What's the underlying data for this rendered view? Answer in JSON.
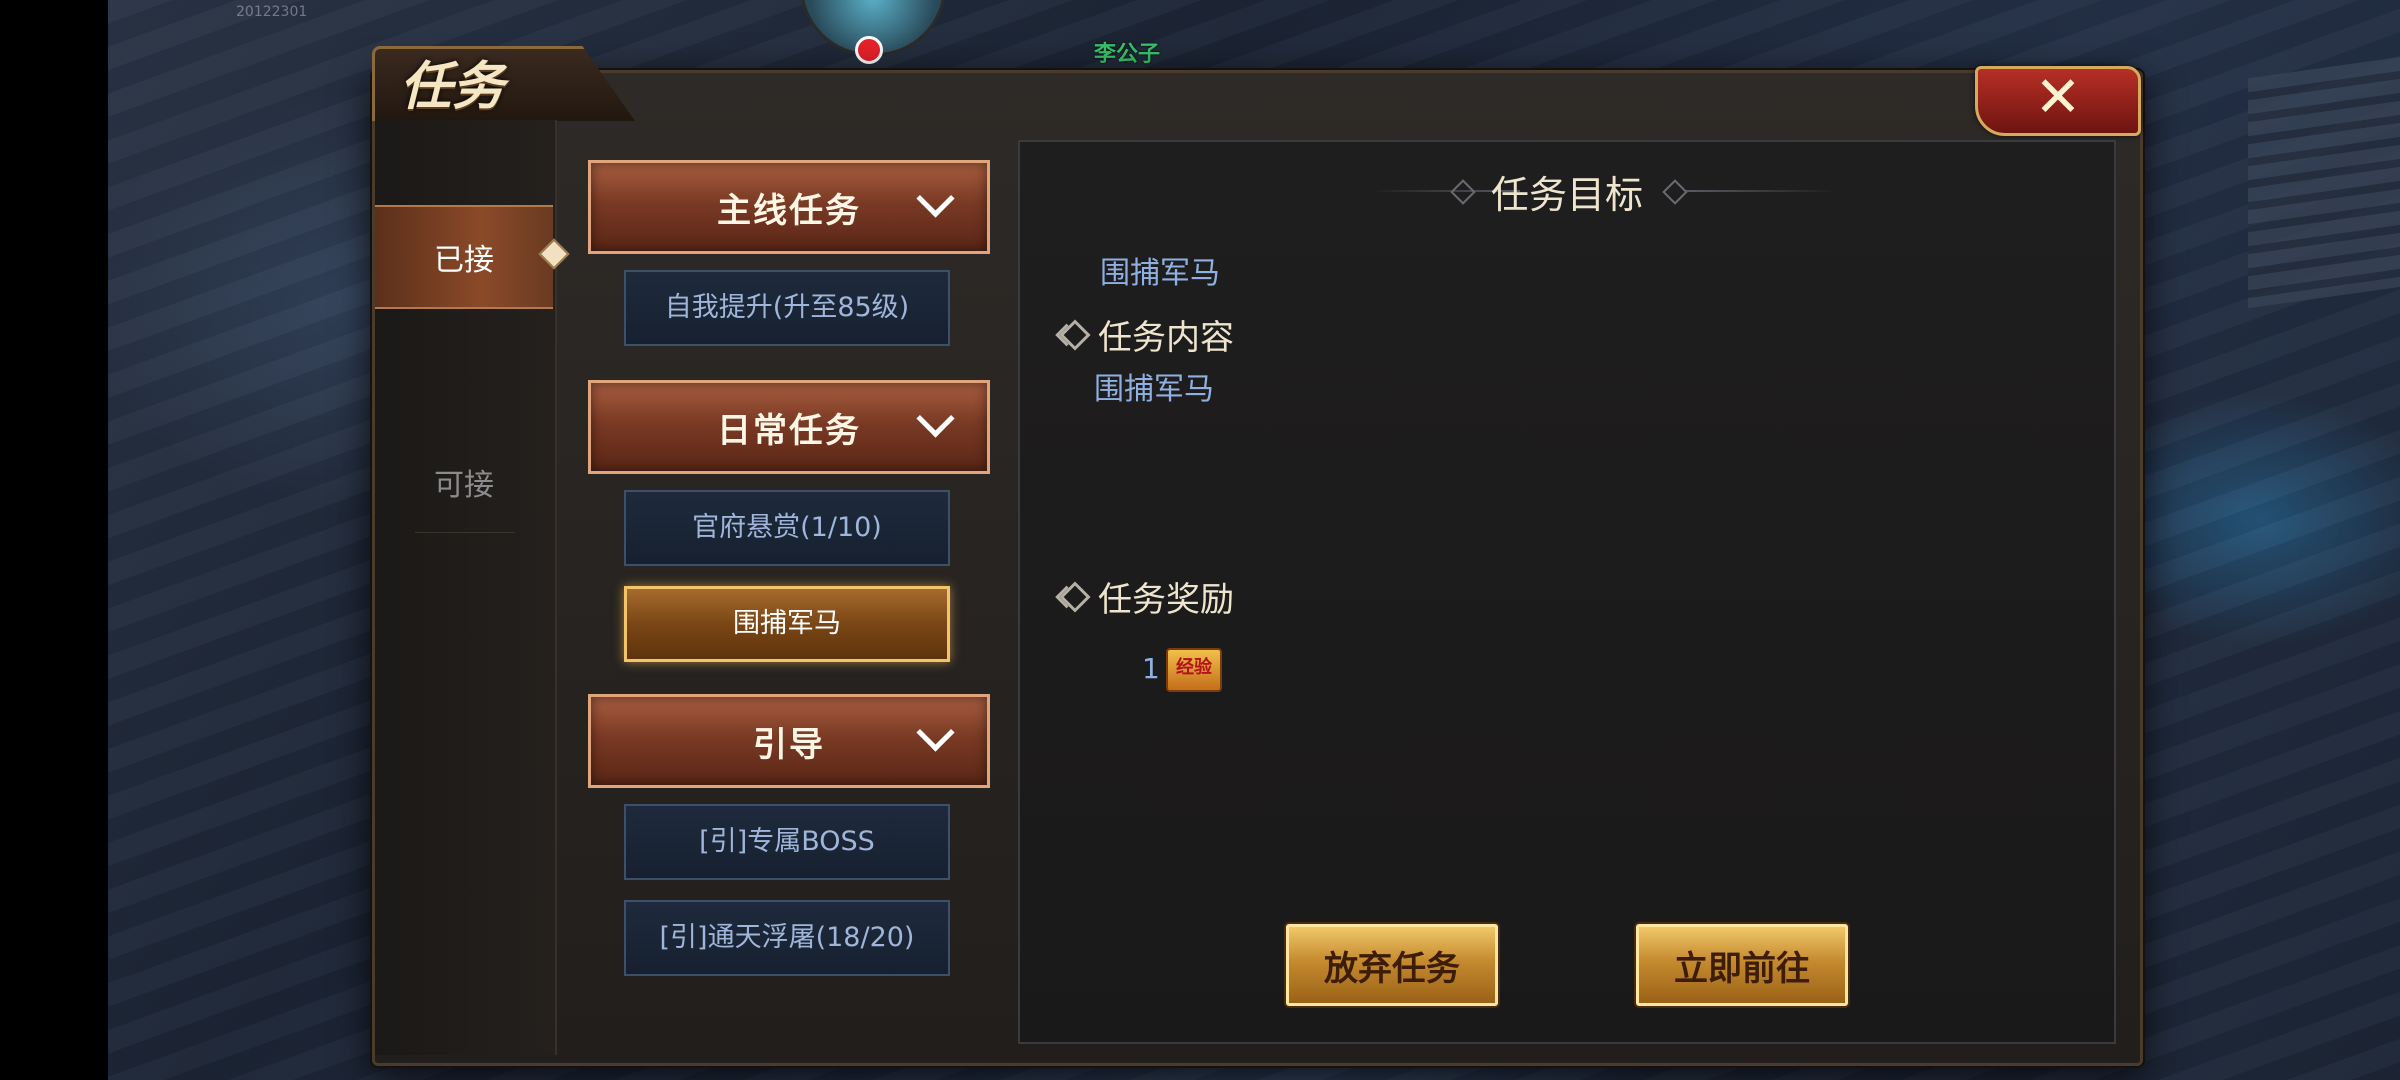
{
  "hud": {
    "timestamp": "20122301",
    "npc_name": "李公子"
  },
  "window": {
    "title": "任务",
    "close_symbol": "✕"
  },
  "tabs": [
    {
      "label": "已接",
      "active": true
    },
    {
      "label": "可接",
      "active": false
    }
  ],
  "categories": [
    {
      "label": "主线任务",
      "tasks": [
        {
          "label": "自我提升(升至85级)",
          "selected": false
        }
      ]
    },
    {
      "label": "日常任务",
      "tasks": [
        {
          "label": "官府悬赏(1/10)",
          "selected": false
        },
        {
          "label": "围捕军马",
          "selected": true
        }
      ]
    },
    {
      "label": "引导",
      "tasks": [
        {
          "label": "[引]专属BOSS",
          "selected": false
        },
        {
          "label": "[引]通天浮屠(18/20)",
          "selected": false
        }
      ]
    }
  ],
  "detail": {
    "objective_title": "任务目标",
    "objective_text": "围捕军马",
    "content_title": "任务内容",
    "content_text": "围捕军马",
    "reward_title": "任务奖励",
    "reward_count": "1",
    "reward_icon_text": "经验",
    "abandon_label": "放弃任务",
    "go_label": "立即前往"
  },
  "colors": {
    "accent_gold": "#f0c86a",
    "category_red": "#7a3a24",
    "task_blue_text": "#9fb5d9",
    "detail_text_blue": "#8fb0e0"
  }
}
